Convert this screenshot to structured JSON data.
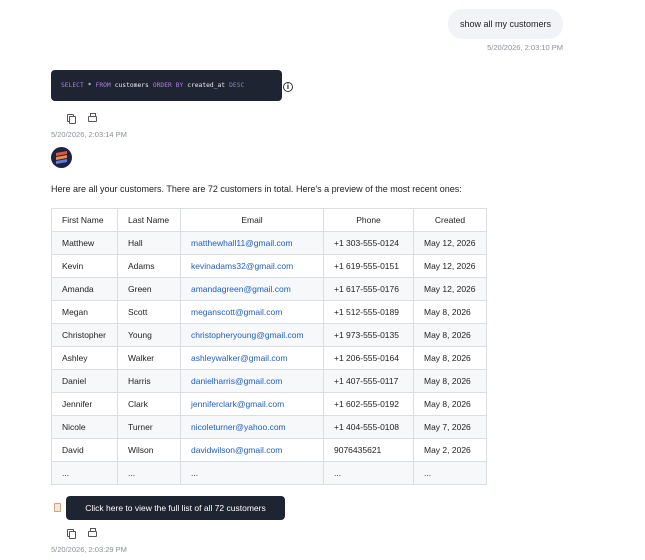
{
  "user_message": {
    "text": "show all my customers",
    "timestamp": "5/20/2026, 2:03:10 PM"
  },
  "query": {
    "keyword_select": "SELECT",
    "star": "*",
    "keyword_from": "FROM",
    "table": "customers",
    "keyword_order": "ORDER BY",
    "column": "created_at",
    "keyword_desc": "DESC",
    "info_icon": "info-icon",
    "timestamp": "5/20/2026, 2:03:14 PM"
  },
  "assistant": {
    "intro": "Here are all your customers. There are 72 customers in total. Here's a preview of the most recent ones:",
    "table": {
      "columns": [
        "First Name",
        "Last Name",
        "Email",
        "Phone",
        "Created"
      ],
      "rows": [
        [
          "Matthew",
          "Hall",
          "matthewhall11@gmail.com",
          "+1 303-555-0124",
          "May 12, 2026"
        ],
        [
          "Kevin",
          "Adams",
          "kevinadams32@gmail.com",
          "+1 619-555-0151",
          "May 12, 2026"
        ],
        [
          "Amanda",
          "Green",
          "amandagreen@gmail.com",
          "+1 617-555-0176",
          "May 12, 2026"
        ],
        [
          "Megan",
          "Scott",
          "meganscott@gmail.com",
          "+1 512-555-0189",
          "May 8, 2026"
        ],
        [
          "Christopher",
          "Young",
          "christopheryoung@gmail.com",
          "+1 973-555-0135",
          "May 8, 2026"
        ],
        [
          "Ashley",
          "Walker",
          "ashleywalker@gmail.com",
          "+1 206-555-0164",
          "May 8, 2026"
        ],
        [
          "Daniel",
          "Harris",
          "danielharris@gmail.com",
          "+1 407-555-0117",
          "May 8, 2026"
        ],
        [
          "Jennifer",
          "Clark",
          "jenniferclark@gmail.com",
          "+1 602-555-0192",
          "May 8, 2026"
        ],
        [
          "Nicole",
          "Turner",
          "nicoleturner@yahoo.com",
          "+1 404-555-0108",
          "May 7, 2026"
        ],
        [
          "David",
          "Wilson",
          "davidwilson@gmail.com",
          "9076435621",
          "May 2, 2026"
        ],
        [
          "...",
          "...",
          "...",
          "...",
          "..."
        ]
      ]
    },
    "cta_label": "Click here to view the full list of all 72 customers",
    "timestamp": "5/20/2026, 2:03:29 PM"
  },
  "colors": {
    "dark_block": "#1f2432",
    "link": "#1f5fbf",
    "bubble": "#f1f3f7"
  }
}
